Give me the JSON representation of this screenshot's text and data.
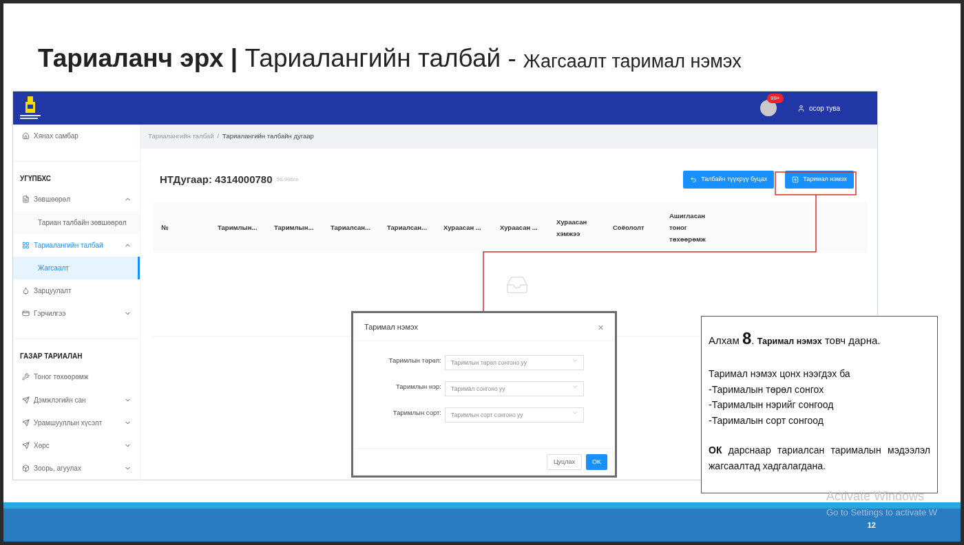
{
  "slide_title": {
    "main": "**Тариаланч эрх |** Тариалангийн талбай -",
    "sub": "Жагсаалт таримал нэмэх"
  },
  "header": {
    "notification_badge": "99+",
    "user": "осор тува"
  },
  "sidebar": {
    "items": [
      {
        "kind": "link",
        "label": "Хянах самбар"
      },
      {
        "kind": "divider"
      },
      {
        "kind": "section",
        "label": "УГҮПБХС"
      },
      {
        "kind": "link",
        "label": "Зөвшөөрөл",
        "expanded": true,
        "selected": false
      },
      {
        "kind": "sublink",
        "label": "Тариан талбайн зөвшөөрөл",
        "selected": false
      },
      {
        "kind": "link",
        "label": "Тариалангийн талбай",
        "expanded": true,
        "selected": true
      },
      {
        "kind": "sublink",
        "label": "Жагсаалт",
        "selected": true
      },
      {
        "kind": "link",
        "label": "Зарцуулалт",
        "selected": false
      },
      {
        "kind": "link",
        "label": "Гэрчилгээ",
        "expanded": false,
        "selected": false
      },
      {
        "kind": "divider"
      },
      {
        "kind": "section",
        "label": "ГАЗАР ТАРИАЛАН"
      },
      {
        "kind": "link",
        "label": "Тоног төхөөрөмж",
        "selected": false
      },
      {
        "kind": "link",
        "label": "Дэмжлэгийн сан",
        "expanded": false,
        "selected": false
      },
      {
        "kind": "link",
        "label": "Урамшууллын хүсэлт",
        "expanded": false,
        "selected": false
      },
      {
        "kind": "link",
        "label": "Хөрс",
        "expanded": false,
        "selected": false
      },
      {
        "kind": "link",
        "label": "Зоорь, агуулах",
        "expanded": false,
        "selected": false
      }
    ]
  },
  "breadcrumb": [
    "Тариалангийн талбай",
    "/",
    "Тариалангийн талбайн дугаар"
  ],
  "page": {
    "title": "НТДугаар: 4314000780",
    "area": "56.946га",
    "buttons": [
      {
        "label": "Талбайн түүхрүү буцах",
        "kind": "back"
      },
      {
        "label": "Таримал нэмэх",
        "kind": "add"
      }
    ]
  },
  "table": {
    "columns": [
      "№",
      "Таримлын...",
      "Таримлын...",
      "Тариалсан...",
      "Тариалсан...",
      "Хураасан ...",
      "Хураасан ...",
      "Хураасан хэмжээ",
      "Соёололт",
      "Ашигласан тоног төхөөрөмж"
    ]
  },
  "modal": {
    "title": "Таримал нэмэх",
    "close": "×",
    "fields": [
      {
        "label": "Таримлын төрөл:",
        "placeholder": "Таримлын төрөл сонгоно уу"
      },
      {
        "label": "Таримлын нэр:",
        "placeholder": "Таримал сонгоно уу"
      },
      {
        "label": "Таримлын сорт:",
        "placeholder": "Таримлын сорт сонгоно уу"
      }
    ],
    "buttons": [
      {
        "label": "Цуцлах",
        "primary": false
      },
      {
        "label": "OK",
        "primary": true
      }
    ]
  },
  "callout": {
    "step": "Алхам **8**. **Таримал нэмэх** товч дарна.",
    "lines": [
      "Таримал нэмэх цонх нээгдэх ба",
      "-Тарималын төрөл сонгох",
      "-Тарималын нэрийг сонгоод",
      "-Тарималын сорт сонгоод"
    ],
    "note": "**ОК** дарснаар тариалсан тарималын мэдээлэл жагсаалтад хадгалагдана."
  },
  "os_notice": {
    "title": "Activate Windows",
    "text": "Go to Settings to activate W"
  },
  "page_number": "12"
}
